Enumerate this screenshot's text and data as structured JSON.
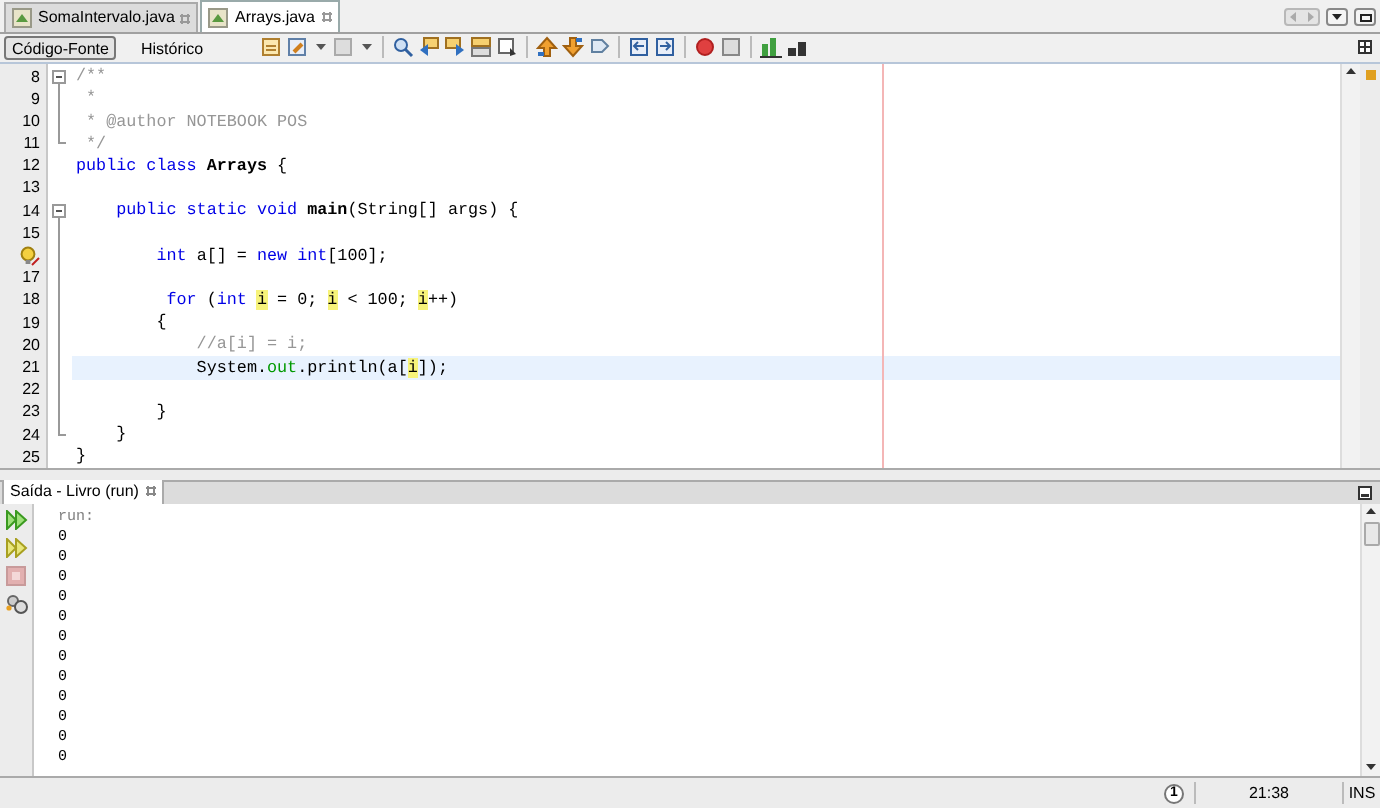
{
  "file_tabs": [
    {
      "label": "SomaIntervalo.java",
      "selected": false
    },
    {
      "label": "Arrays.java",
      "selected": true
    }
  ],
  "editor_modes": [
    {
      "label": "Código-Fonte",
      "selected": true
    },
    {
      "label": "Histórico",
      "selected": false
    }
  ],
  "editor": {
    "lines": [
      {
        "number": "8",
        "fold_start": true,
        "current": false,
        "tokens": [
          {
            "kind": "comment",
            "text": "/**"
          }
        ]
      },
      {
        "number": "9",
        "current": false,
        "tokens": [
          {
            "kind": "comment",
            "text": " *"
          }
        ]
      },
      {
        "number": "10",
        "current": false,
        "tokens": [
          {
            "kind": "comment",
            "text": " * @author NOTEBOOK POS"
          }
        ]
      },
      {
        "number": "11",
        "fold_end": true,
        "current": false,
        "tokens": [
          {
            "kind": "comment",
            "text": " */"
          }
        ]
      },
      {
        "number": "12",
        "current": false,
        "tokens": [
          {
            "kind": "keyword",
            "text": "public class "
          },
          {
            "kind": "bold",
            "text": "Arrays"
          },
          {
            "kind": "plain",
            "text": " {"
          }
        ]
      },
      {
        "number": "13",
        "current": false
      },
      {
        "number": "14",
        "fold_start": true,
        "current": false,
        "tokens": [
          {
            "kind": "keyword",
            "text": "    public static void "
          },
          {
            "kind": "bold",
            "text": "main"
          },
          {
            "kind": "plain",
            "text": "(String[] args) {"
          }
        ]
      },
      {
        "number": "15",
        "current": false
      },
      {
        "hint": true,
        "current": false,
        "tokens": [
          {
            "kind": "keyword",
            "text": "        int "
          },
          {
            "kind": "plain",
            "text": "a[] = "
          },
          {
            "kind": "keyword",
            "text": "new int"
          },
          {
            "kind": "plain",
            "text": "[100];"
          }
        ]
      },
      {
        "number": "17",
        "current": false
      },
      {
        "number": "18",
        "current": false,
        "tokens": [
          {
            "kind": "keyword",
            "text": "         for"
          },
          {
            "kind": "plain",
            "text": " ("
          },
          {
            "kind": "keyword",
            "text": "int "
          },
          {
            "kind": "mark",
            "text": "i"
          },
          {
            "kind": "plain",
            "text": " = 0; "
          },
          {
            "kind": "mark",
            "text": "i"
          },
          {
            "kind": "plain",
            "text": " < 100; "
          },
          {
            "kind": "mark",
            "text": "i"
          },
          {
            "kind": "plain",
            "text": "++)"
          }
        ]
      },
      {
        "number": "19",
        "current": false,
        "tokens": [
          {
            "kind": "plain",
            "text": "        {"
          }
        ]
      },
      {
        "number": "20",
        "current": false,
        "tokens": [
          {
            "kind": "comment",
            "text": "            //a[i] = i;"
          }
        ]
      },
      {
        "number": "21",
        "current": true,
        "tokens": [
          {
            "kind": "plain",
            "text": "            System."
          },
          {
            "kind": "field",
            "text": "out"
          },
          {
            "kind": "plain",
            "text": ".println(a["
          },
          {
            "kind": "mark",
            "text": "i"
          },
          {
            "kind": "plain",
            "text": "]);"
          }
        ]
      },
      {
        "number": "22",
        "current": false
      },
      {
        "number": "23",
        "current": false,
        "tokens": [
          {
            "kind": "plain",
            "text": "        }"
          }
        ]
      },
      {
        "number": "24",
        "fold_end": true,
        "current": false,
        "tokens": [
          {
            "kind": "plain",
            "text": "    }"
          }
        ]
      },
      {
        "number": "25",
        "current": false,
        "tokens": [
          {
            "kind": "plain",
            "text": "}"
          }
        ]
      }
    ]
  },
  "output": {
    "tab": "Saída - Livro (run)",
    "lines": [
      {
        "kind": "info",
        "text": "run:"
      },
      {
        "kind": "out",
        "text": "0"
      },
      {
        "kind": "out",
        "text": "0"
      },
      {
        "kind": "out",
        "text": "0"
      },
      {
        "kind": "out",
        "text": "0"
      },
      {
        "kind": "out",
        "text": "0"
      },
      {
        "kind": "out",
        "text": "0"
      },
      {
        "kind": "out",
        "text": "0"
      },
      {
        "kind": "out",
        "text": "0"
      },
      {
        "kind": "out",
        "text": "0"
      },
      {
        "kind": "out",
        "text": "0"
      },
      {
        "kind": "out",
        "text": "0"
      },
      {
        "kind": "out",
        "text": "0"
      }
    ]
  },
  "status_bar": {
    "notifications": "1",
    "position": "21:38",
    "mode": "INS"
  }
}
